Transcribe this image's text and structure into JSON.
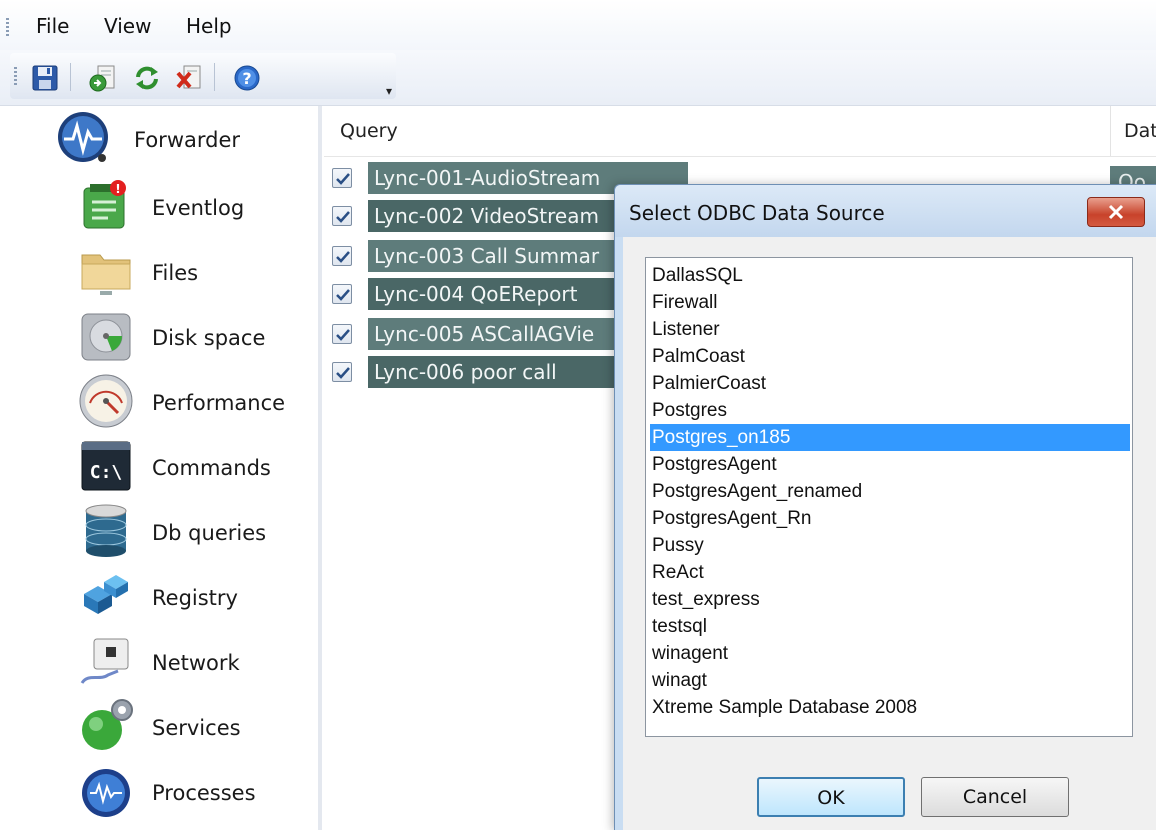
{
  "menu": {
    "file": "File",
    "view": "View",
    "help": "Help"
  },
  "toolbar": {
    "icons": [
      "save-icon",
      "import-icon",
      "refresh-icon",
      "delete-icon",
      "help-icon"
    ]
  },
  "sidebar": {
    "items": [
      {
        "label": "Forwarder",
        "icon": "forwarder-icon"
      },
      {
        "label": "Eventlog",
        "icon": "eventlog-icon"
      },
      {
        "label": "Files",
        "icon": "folder-icon"
      },
      {
        "label": "Disk space",
        "icon": "disk-icon"
      },
      {
        "label": "Performance",
        "icon": "gauge-icon"
      },
      {
        "label": "Commands",
        "icon": "console-icon"
      },
      {
        "label": "Db queries",
        "icon": "database-icon"
      },
      {
        "label": "Registry",
        "icon": "registry-icon"
      },
      {
        "label": "Network",
        "icon": "network-icon"
      },
      {
        "label": "Services",
        "icon": "services-icon"
      },
      {
        "label": "Processes",
        "icon": "processes-icon"
      }
    ]
  },
  "main": {
    "columns": {
      "query": "Query",
      "second": "Dat"
    },
    "queries": [
      {
        "label": "Lync-001-AudioStream",
        "checked": true
      },
      {
        "label": "Lync-002 VideoStream",
        "checked": true
      },
      {
        "label": "Lync-003 Call Summar",
        "checked": true
      },
      {
        "label": "Lync-004 QoEReport",
        "checked": true
      },
      {
        "label": "Lync-005 ASCallAGVie",
        "checked": true
      },
      {
        "label": "Lync-006 poor call",
        "checked": true
      }
    ],
    "first_row_extra": "Oo"
  },
  "dialog": {
    "title": "Select ODBC Data Source",
    "sources": [
      "DallasSQL",
      "Firewall",
      "Listener",
      "PalmCoast",
      "PalmierCoast",
      "Postgres",
      "Postgres_on185",
      "PostgresAgent",
      "PostgresAgent_renamed",
      "PostgresAgent_Rn",
      "Pussy",
      "ReAct",
      "test_express",
      "testsql",
      "winagent",
      "winagt",
      "Xtreme Sample Database 2008"
    ],
    "selected": "Postgres_on185",
    "ok": "OK",
    "cancel": "Cancel"
  },
  "colors": {
    "selection": "#3399ff",
    "query_row": "#5e7c7b",
    "dialog_frame": "#c9ddf2"
  }
}
